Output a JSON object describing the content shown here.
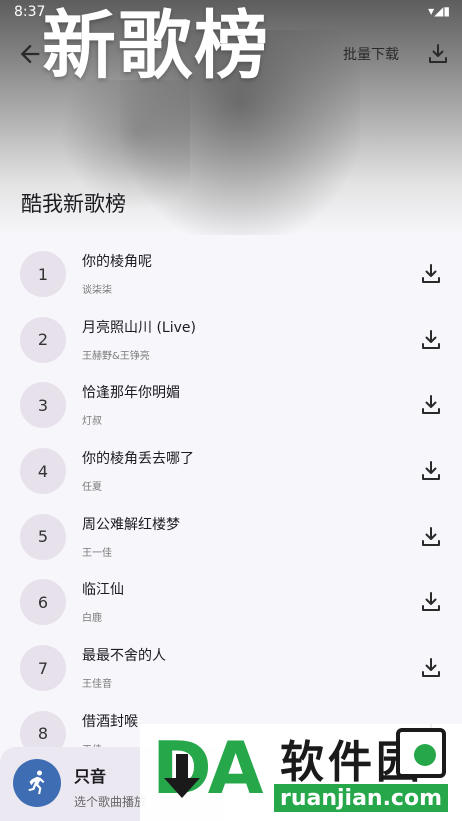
{
  "status": {
    "time": "8:37",
    "icons": "▾◢▮"
  },
  "header": {
    "banner_text": "新歌榜",
    "batch_download": "批量下载",
    "list_title": "酷我新歌榜"
  },
  "songs": [
    {
      "rank": "1",
      "title": "你的棱角呢",
      "artist": "谈柒柒"
    },
    {
      "rank": "2",
      "title": "月亮照山川 (Live)",
      "artist": "王赫野&王铮亮"
    },
    {
      "rank": "3",
      "title": "恰逢那年你明媚",
      "artist": "灯叔"
    },
    {
      "rank": "4",
      "title": "你的棱角丢去哪了",
      "artist": "任夏"
    },
    {
      "rank": "5",
      "title": "周公难解红楼梦",
      "artist": "王一佳"
    },
    {
      "rank": "6",
      "title": "临江仙",
      "artist": "白鹿"
    },
    {
      "rank": "7",
      "title": "最最不舍的人",
      "artist": "王佳音"
    },
    {
      "rank": "8",
      "title": "借酒封喉",
      "artist": "王佳"
    }
  ],
  "player": {
    "title": "只音",
    "subtitle": "选个歌曲播放"
  },
  "watermark": {
    "brand": "DA",
    "name": "软件园",
    "url": "ruanjian.com"
  },
  "colors": {
    "rank_bg": "#e7e1ec",
    "player_bg": "#ece8f2",
    "accent": "#3f6db3",
    "watermark_green": "#26a84a"
  }
}
